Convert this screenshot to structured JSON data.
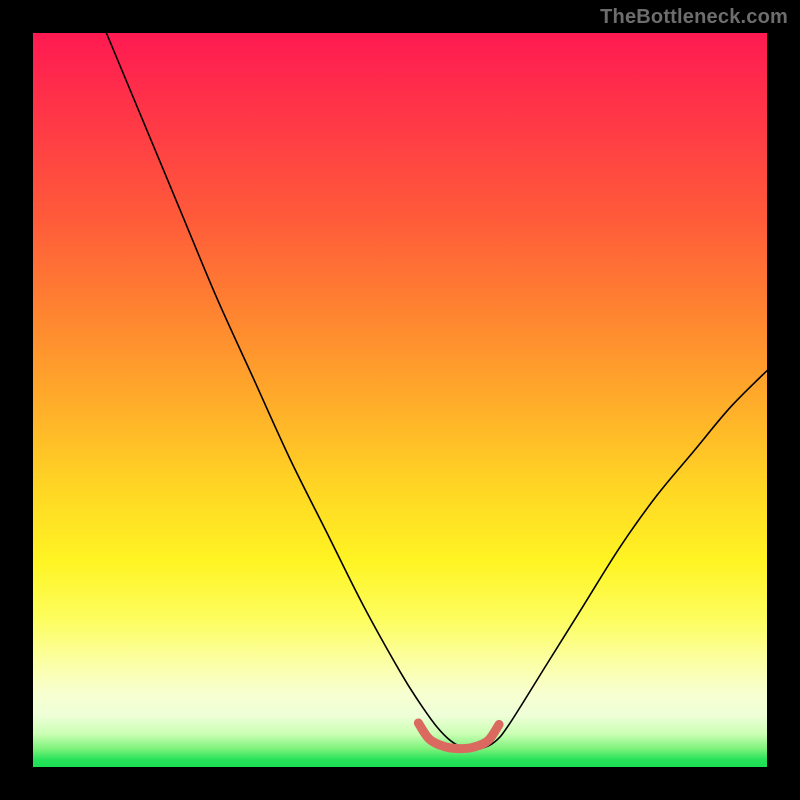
{
  "watermark": "TheBottleneck.com",
  "chart_data": {
    "type": "line",
    "title": "",
    "xlabel": "",
    "ylabel": "",
    "xlim": [
      0,
      100
    ],
    "ylim": [
      0,
      100
    ],
    "series": [
      {
        "name": "black-curve",
        "color": "#000000",
        "x": [
          10,
          15,
          20,
          25,
          30,
          35,
          40,
          45,
          50,
          52.5,
          55,
          57,
          59,
          61,
          63,
          65,
          70,
          75,
          80,
          85,
          90,
          95,
          100
        ],
        "y": [
          100,
          88,
          76,
          64,
          53,
          42,
          32,
          22,
          13,
          9,
          5.5,
          3.5,
          2.5,
          2.5,
          3.5,
          6,
          14,
          22,
          30,
          37,
          43,
          49,
          54
        ]
      },
      {
        "name": "salmon-segment",
        "color": "#da6a5f",
        "x": [
          52.5,
          54,
          56,
          58,
          60,
          62,
          63.5
        ],
        "y": [
          6.0,
          3.8,
          2.8,
          2.5,
          2.7,
          3.6,
          5.8
        ]
      }
    ],
    "background_gradient": {
      "top": "#ff1a52",
      "middle": "#ffd624",
      "bottom": "#1adf52"
    }
  }
}
